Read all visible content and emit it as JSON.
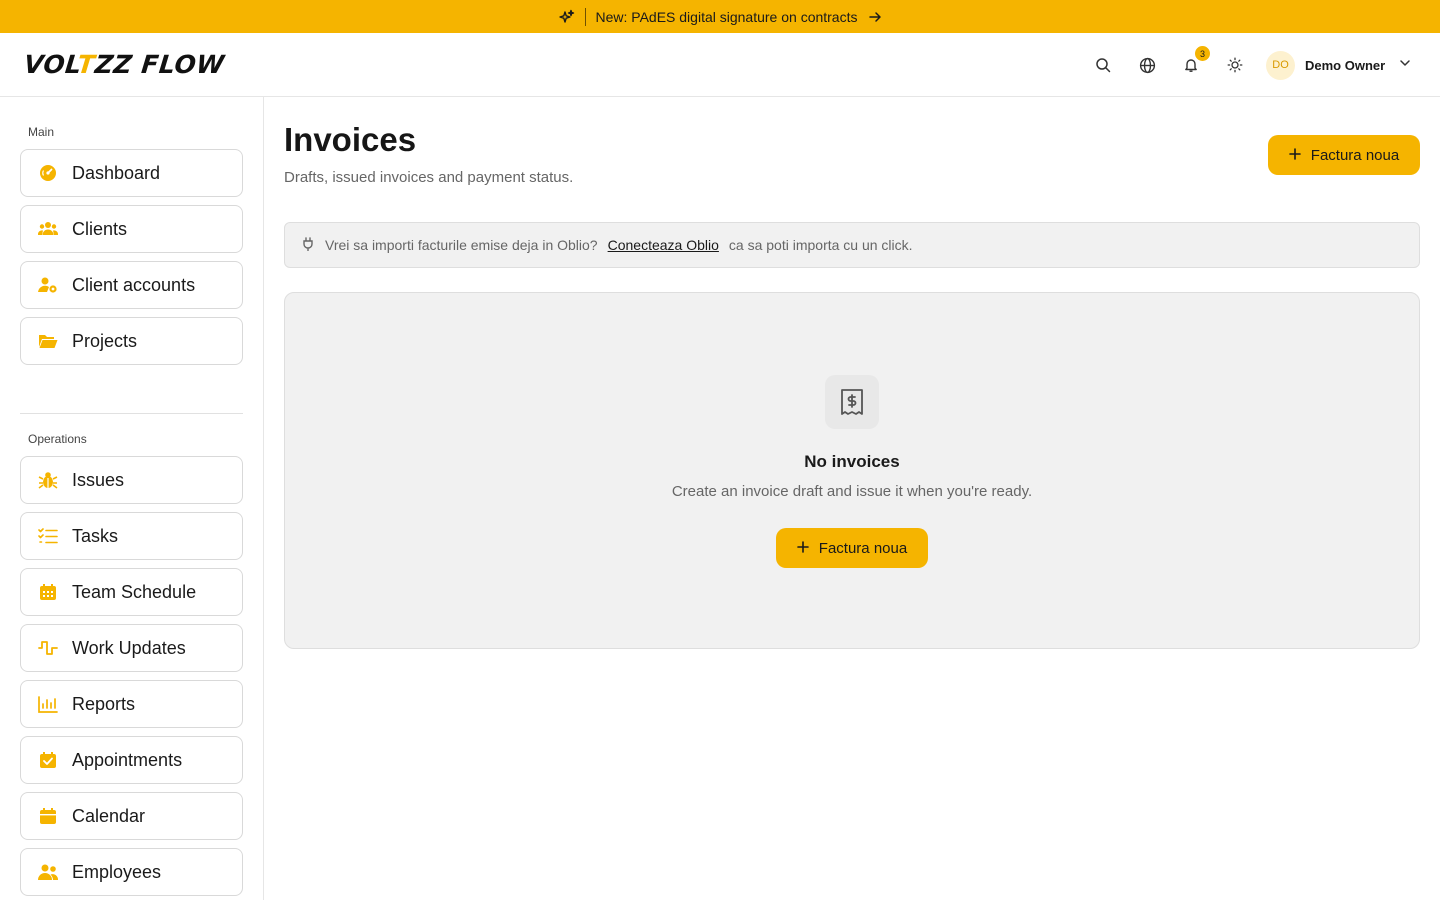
{
  "announcement": {
    "text": "New: PAdES digital signature on contracts",
    "icon": "sparkles-icon",
    "arrow_icon": "arrow-right-icon"
  },
  "header": {
    "logo_prefix": "VOL",
    "logo_accent": "T",
    "logo_suffix": "ZZ FLOW",
    "notifications_count": "3",
    "user_initials": "DO",
    "user_name": "Demo Owner"
  },
  "sidebar": {
    "main_label": "Main",
    "main_items": [
      {
        "label": "Dashboard",
        "icon": "gauge-icon"
      },
      {
        "label": "Clients",
        "icon": "users-icon"
      },
      {
        "label": "Client accounts",
        "icon": "user-gear-icon"
      },
      {
        "label": "Projects",
        "icon": "folder-open-icon"
      }
    ],
    "ops_label": "Operations",
    "ops_items": [
      {
        "label": "Issues",
        "icon": "bug-icon"
      },
      {
        "label": "Tasks",
        "icon": "list-check-icon"
      },
      {
        "label": "Team Schedule",
        "icon": "calendar-grid-icon"
      },
      {
        "label": "Work Updates",
        "icon": "pulse-icon"
      },
      {
        "label": "Reports",
        "icon": "bar-chart-icon"
      },
      {
        "label": "Appointments",
        "icon": "calendar-check-icon"
      },
      {
        "label": "Calendar",
        "icon": "calendar-icon"
      },
      {
        "label": "Employees",
        "icon": "people-icon"
      }
    ]
  },
  "main": {
    "title": "Invoices",
    "subtitle": "Drafts, issued invoices and payment status.",
    "new_button": "Factura noua",
    "info": {
      "text": "Vrei sa importi facturile emise deja in Oblio?",
      "link": "Conecteaza Oblio",
      "suffix": "ca sa poti importa cu un click."
    },
    "empty": {
      "title": "No invoices",
      "subtitle": "Create an invoice draft and issue it when you're ready.",
      "button": "Factura noua"
    }
  },
  "colors": {
    "accent": "#f5b400",
    "panel": "#f1f1f1"
  }
}
